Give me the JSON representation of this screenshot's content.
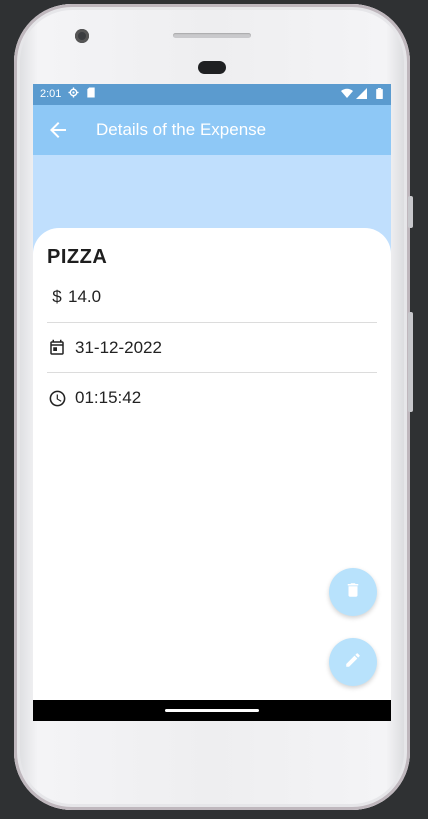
{
  "status_bar": {
    "time": "2:01",
    "icons": [
      "settings-icon",
      "sim-card-icon",
      "wifi-icon",
      "signal-icon",
      "battery-icon"
    ]
  },
  "app_bar": {
    "title": "Details of the Expense",
    "back_icon": "arrow-back-icon"
  },
  "expense": {
    "name": "PIZZA",
    "amount": "14.0",
    "amount_icon": "dollar-icon",
    "amount_symbol": "$",
    "date": "31-12-2022",
    "date_icon": "calendar-icon",
    "time": "01:15:42",
    "time_icon": "clock-icon"
  },
  "actions": {
    "delete_icon": "trash-icon",
    "edit_icon": "pencil-icon"
  },
  "colors": {
    "status_bar": "#5b9bcf",
    "app_bar": "#8ec8f6",
    "header_band": "#c0dffd",
    "fab": "#b8e2fc",
    "fab_icon": "#ffffff",
    "text": "#222222"
  }
}
